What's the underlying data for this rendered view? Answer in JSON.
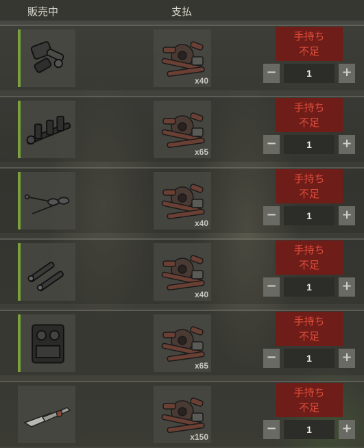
{
  "header": {
    "sell_label": "販売中",
    "pay_label": "支払"
  },
  "colors": {
    "accent": "#7aa23c",
    "warning_bg": "#6e1d18",
    "warning_text": "#e04d3c"
  },
  "rows": [
    {
      "item_icon": "piston-icon",
      "accent": true,
      "pay_icon": "metal-scrap-icon",
      "pay_qty": "x40",
      "warn_line1": "手持ち",
      "warn_line2": "不足",
      "minus": "−",
      "qty": "1",
      "plus": "+"
    },
    {
      "item_icon": "crankshaft-icon",
      "accent": true,
      "pay_icon": "metal-scrap-icon",
      "pay_qty": "x65",
      "warn_line1": "手持ち",
      "warn_line2": "不足",
      "minus": "−",
      "qty": "1",
      "plus": "+"
    },
    {
      "item_icon": "valves-icon",
      "accent": true,
      "pay_icon": "metal-scrap-icon",
      "pay_qty": "x40",
      "warn_line1": "手持ち",
      "warn_line2": "不足",
      "minus": "−",
      "qty": "1",
      "plus": "+"
    },
    {
      "item_icon": "spark-plugs-icon",
      "accent": true,
      "pay_icon": "metal-scrap-icon",
      "pay_qty": "x40",
      "warn_line1": "手持ち",
      "warn_line2": "不足",
      "minus": "−",
      "qty": "1",
      "plus": "+"
    },
    {
      "item_icon": "engine-block-icon",
      "accent": true,
      "pay_icon": "metal-scrap-icon",
      "pay_qty": "x65",
      "warn_line1": "手持ち",
      "warn_line2": "不足",
      "minus": "−",
      "qty": "1",
      "plus": "+"
    },
    {
      "item_icon": "carburetor-blade-icon",
      "accent": false,
      "pay_icon": "metal-scrap-icon",
      "pay_qty": "x150",
      "warn_line1": "手持ち",
      "warn_line2": "不足",
      "minus": "−",
      "qty": "1",
      "plus": "+"
    }
  ]
}
